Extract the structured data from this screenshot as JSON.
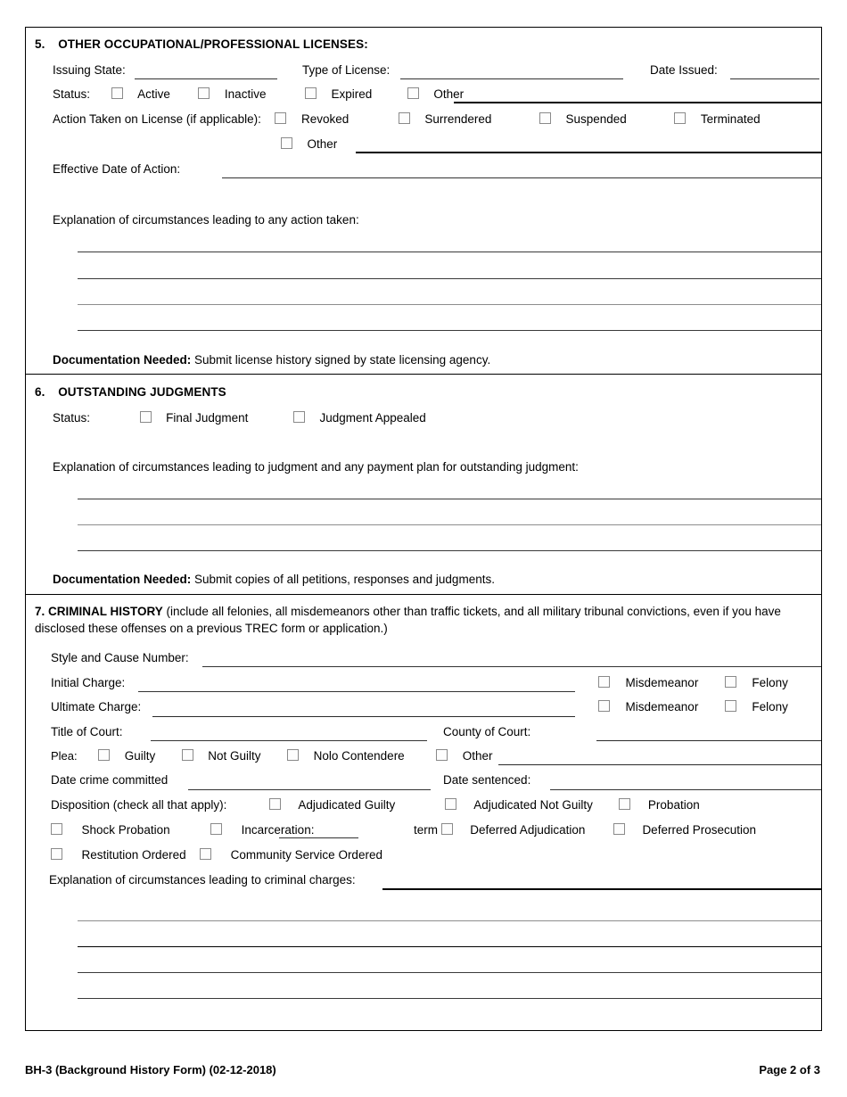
{
  "document": {
    "form_code": "BH-3",
    "footer_left": "BH-3 (Background History Form) (02-12-2018)",
    "footer_right": "Page 2 of 3"
  },
  "section5": {
    "number": "5.",
    "title": "OTHER OCCUPATIONAL/PROFESSIONAL LICENSES:",
    "issuing_state_label": "Issuing State:",
    "type_of_license_label": "Type of License:",
    "date_issued_label": "Date Issued:",
    "status_label": "Status:",
    "status_options": [
      "Active",
      "Inactive",
      "Expired",
      "Other"
    ],
    "action_taken_label": "Action Taken on License (if applicable):",
    "action_options": [
      "Revoked",
      "Surrendered",
      "Suspended",
      "Terminated"
    ],
    "action_other_label": "Other",
    "effective_date_label": "Effective Date of Action:",
    "explanation_label": "Explanation of circumstances leading to any action taken:",
    "documentation_bold": "Documentation Needed:",
    "documentation_text": " Submit license history signed by state licensing agency.",
    "blank_lines": 4
  },
  "section6": {
    "number": "6.",
    "title": "OUTSTANDING JUDGMENTS",
    "status_label": "Status:",
    "status_options": [
      "Final Judgment",
      "Judgment Appealed"
    ],
    "explanation_label": "Explanation of circumstances leading to judgment and any payment plan for outstanding judgment:",
    "documentation_bold": "Documentation Needed:",
    "documentation_text": " Submit copies of all petitions, responses and judgments.",
    "blank_lines": 3
  },
  "section7": {
    "number": "7.",
    "title": "CRIMINAL HISTORY",
    "title_note": " (include all felonies, all misdemeanors other than traffic tickets, and all military tribunal convictions, even if you have disclosed these offenses on a previous TREC form or application.)",
    "style_cause_label": "Style and Cause Number:",
    "initial_charge_label": "Initial Charge:",
    "ultimate_charge_label": "Ultimate Charge:",
    "misdemeanor_label": "Misdemeanor",
    "felony_label": "Felony",
    "title_of_court_label": "Title of Court:",
    "county_of_court_label": "County of Court:",
    "plea_label": "Plea:",
    "plea_options": [
      "Guilty",
      "Not Guilty",
      "Nolo Contendere",
      "Other"
    ],
    "date_crime_label": "Date crime committed",
    "date_sentenced_label": "Date sentenced:",
    "disposition_label": "Disposition (check all that apply):",
    "disposition_row1": [
      "Adjudicated Guilty",
      "Adjudicated Not Guilty",
      "Probation"
    ],
    "disposition_row2_shock": "Shock Probation",
    "disposition_row2_incarceration": "Incarceration:",
    "disposition_row2_term": "term",
    "disposition_row2_deferred_adj": "Deferred Adjudication",
    "disposition_row2_deferred_pros": "Deferred Prosecution",
    "disposition_row3_restitution": "Restitution Ordered",
    "disposition_row3_community": "Community Service Ordered",
    "explanation_label": "Explanation of circumstances leading to criminal charges:",
    "blank_lines": 4
  }
}
